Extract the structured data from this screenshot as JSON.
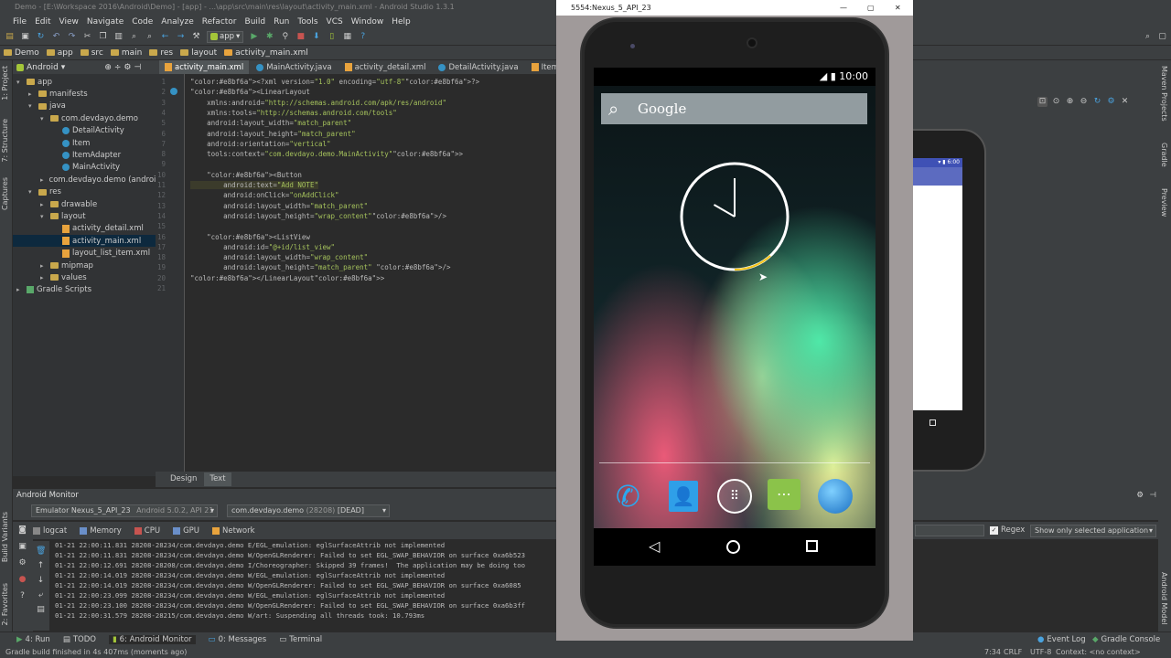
{
  "window": {
    "title": "Demo - [E:\\Workspace 2016\\Android\\Demo] - [app] - ...\\app\\src\\main\\res\\layout\\activity_main.xml - Android Studio 1.3.1"
  },
  "menu": [
    "File",
    "Edit",
    "View",
    "Navigate",
    "Code",
    "Analyze",
    "Refactor",
    "Build",
    "Run",
    "Tools",
    "VCS",
    "Window",
    "Help"
  ],
  "toolbar": {
    "run_config": "app"
  },
  "breadcrumb": [
    "Demo",
    "app",
    "src",
    "main",
    "res",
    "layout",
    "activity_main.xml"
  ],
  "project": {
    "view_mode": "Android",
    "tree": [
      {
        "label": "app",
        "indent": 0,
        "arrow": "▾",
        "icon": "folder"
      },
      {
        "label": "manifests",
        "indent": 1,
        "arrow": "▸",
        "icon": "folder"
      },
      {
        "label": "java",
        "indent": 1,
        "arrow": "▾",
        "icon": "folder"
      },
      {
        "label": "com.devdayo.demo",
        "indent": 2,
        "arrow": "▾",
        "icon": "folder"
      },
      {
        "label": "DetailActivity",
        "indent": 3,
        "arrow": "",
        "icon": "class"
      },
      {
        "label": "Item",
        "indent": 3,
        "arrow": "",
        "icon": "class"
      },
      {
        "label": "ItemAdapter",
        "indent": 3,
        "arrow": "",
        "icon": "class"
      },
      {
        "label": "MainActivity",
        "indent": 3,
        "arrow": "",
        "icon": "class"
      },
      {
        "label": "com.devdayo.demo (androidTest)",
        "indent": 2,
        "arrow": "▸",
        "icon": "folder"
      },
      {
        "label": "res",
        "indent": 1,
        "arrow": "▾",
        "icon": "folder"
      },
      {
        "label": "drawable",
        "indent": 2,
        "arrow": "▸",
        "icon": "folder"
      },
      {
        "label": "layout",
        "indent": 2,
        "arrow": "▾",
        "icon": "folder"
      },
      {
        "label": "activity_detail.xml",
        "indent": 3,
        "arrow": "",
        "icon": "file"
      },
      {
        "label": "activity_main.xml",
        "indent": 3,
        "arrow": "",
        "icon": "file",
        "selected": true
      },
      {
        "label": "layout_list_item.xml",
        "indent": 3,
        "arrow": "",
        "icon": "file"
      },
      {
        "label": "mipmap",
        "indent": 2,
        "arrow": "▸",
        "icon": "folder"
      },
      {
        "label": "values",
        "indent": 2,
        "arrow": "▸",
        "icon": "folder"
      },
      {
        "label": "Gradle Scripts",
        "indent": 0,
        "arrow": "▸",
        "icon": "gradle"
      }
    ]
  },
  "left_strip": [
    "1: Project",
    "7: Structure",
    "Captures",
    "Build Variants",
    "2: Favorites"
  ],
  "right_strip": [
    "Maven Projects",
    "Gradle",
    "Preview",
    "Android Model"
  ],
  "editor": {
    "tabs": [
      {
        "label": "activity_main.xml",
        "active": true
      },
      {
        "label": "MainActivity.java",
        "active": false
      },
      {
        "label": "activity_detail.xml",
        "active": false
      },
      {
        "label": "DetailActivity.java",
        "active": false
      },
      {
        "label": "ItemAda",
        "active": false
      }
    ],
    "lines": [
      "<?xml version=\"1.0\" encoding=\"utf-8\"?>",
      "<LinearLayout",
      "    xmlns:android=\"http://schemas.android.com/apk/res/android\"",
      "    xmlns:tools=\"http://schemas.android.com/tools\"",
      "    android:layout_width=\"match_parent\"",
      "    android:layout_height=\"match_parent\"",
      "    android:orientation=\"vertical\"",
      "    tools:context=\"com.devdayo.demo.MainActivity\">",
      "",
      "    <Button",
      "        android:text=\"Add NOTE\"",
      "        android:onClick=\"onAddClick\"",
      "        android:layout_width=\"match_parent\"",
      "        android:layout_height=\"wrap_content\"/>",
      "",
      "    <ListView",
      "        android:id=\"@+id/list_view\"",
      "        android:layout_width=\"wrap_content\"",
      "        android:layout_height=\"match_parent\" />",
      "</LinearLayout>",
      ""
    ],
    "design_tab": "Design",
    "text_tab": "Text"
  },
  "monitor": {
    "title": "Android Monitor",
    "device": "Emulator Nexus_5_API_23",
    "api": "Android 5.0.2, API 21",
    "process": "com.devdayo.demo",
    "pid": "(28208)",
    "state": "[DEAD]",
    "tabs": [
      "logcat",
      "Memory",
      "CPU",
      "GPU",
      "Network"
    ],
    "regex_label": "Regex",
    "filter": "Show only selected application",
    "log": [
      "01-21 22:00:11.831 28208-28234/com.devdayo.demo E/EGL_emulation: eglSurfaceAttrib not implemented",
      "01-21 22:00:11.831 28208-28234/com.devdayo.demo W/OpenGLRenderer: Failed to set EGL_SWAP_BEHAVIOR on surface 0xa6b523",
      "01-21 22:00:12.691 28208-28208/com.devdayo.demo I/Choreographer: Skipped 39 frames!  The application may be doing too",
      "01-21 22:00:14.019 28208-28234/com.devdayo.demo W/EGL_emulation: eglSurfaceAttrib not implemented",
      "01-21 22:00:14.019 28208-28234/com.devdayo.demo W/OpenGLRenderer: Failed to set EGL_SWAP_BEHAVIOR on surface 0xa6085",
      "01-21 22:00:23.099 28208-28234/com.devdayo.demo W/EGL_emulation: eglSurfaceAttrib not implemented",
      "01-21 22:00:23.100 28208-28234/com.devdayo.demo W/OpenGLRenderer: Failed to set EGL_SWAP_BEHAVIOR on surface 0xa6b3ff",
      "01-21 22:00:31.579 28208-28215/com.devdayo.demo W/art: Suspending all threads took: 10.793ms"
    ]
  },
  "bottom_tabs": [
    "4: Run",
    "TODO",
    "6: Android Monitor",
    "0: Messages",
    "Terminal"
  ],
  "bottom_right_tabs": [
    "Event Log",
    "Gradle Console"
  ],
  "status": {
    "message": "Gradle build finished in 4s 407ms (moments ago)",
    "position": "7:34",
    "line_sep": "CRLF",
    "encoding": "UTF-8",
    "context": "Context: <no context>"
  },
  "emulator": {
    "title": "5554:Nexus_5_API_23",
    "time": "10:00",
    "search_label": "Google",
    "clock_hour": 10,
    "clock_minute": 0
  },
  "colors": {
    "accent": "#3592c4",
    "selection": "#0d293e",
    "tag": "#e8bf6a",
    "attr": "#bababa",
    "string": "#a5c25c"
  }
}
